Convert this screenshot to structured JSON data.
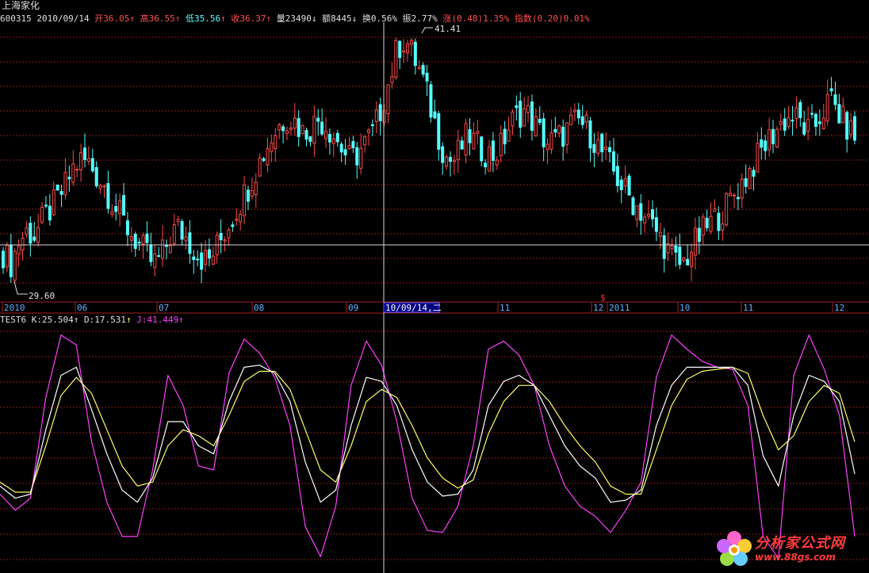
{
  "stock": {
    "name": "上海家化",
    "code": "600315",
    "date": "2010/09/14",
    "open_label": "开",
    "open": "36.05",
    "high_label": "高",
    "high": "36.55",
    "low_label": "低",
    "low": "35.56",
    "close_label": "收",
    "close": "36.37",
    "vol_label": "量",
    "vol": "23490",
    "amt_label": "额",
    "amt": "8445",
    "turn_label": "换",
    "turn": "0.56%",
    "amp_label": "振",
    "amp": "2.77%",
    "chg_label": "涨",
    "chg": "(0.48)",
    "chg_pct": "1.35%",
    "idx_label": "指数",
    "idx": "(0.20)",
    "idx_pct": "0.01%"
  },
  "price_marks": {
    "high": "41.41",
    "low": "29.60"
  },
  "x_axis": {
    "labels": [
      "2010",
      "06",
      "07",
      "08",
      "09",
      "11",
      "12",
      "2011",
      "10",
      "11",
      "12"
    ],
    "cursor_label": "10/09/14,二",
    "marker": "$"
  },
  "indicator": {
    "name": "TEST6",
    "k_label": "K:",
    "k": "25.504",
    "d_label": "D:",
    "d": "17.531",
    "j_label": "J:",
    "j": "41.449"
  },
  "watermark": {
    "title": "分析家公式网",
    "url": "www.88gs.com"
  },
  "colors": {
    "up": "#ff4a4a",
    "down": "#54ffff",
    "k": "#ffffff",
    "d": "#ffff66",
    "j": "#ff40ff",
    "grid": "#8a1a1a"
  },
  "chart_data": [
    {
      "type": "candlestick",
      "title": "上海家化",
      "x": "trading days (approx. 2010-05 to 2011-12)",
      "ylim": [
        29.6,
        41.41
      ],
      "close_path": [
        31,
        30.5,
        31.5,
        32,
        31.8,
        32.5,
        33,
        33.5,
        34.2,
        35,
        35.3,
        35.1,
        34.5,
        34,
        33.2,
        32.6,
        32,
        31.5,
        31,
        30.5,
        30.8,
        31.6,
        32.2,
        31.8,
        31.3,
        30.8,
        30.6,
        31.2,
        31.9,
        32.6,
        33.3,
        34,
        34.8,
        35.6,
        36.3,
        36.9,
        37.3,
        37.1,
        36.6,
        36.8,
        37.2,
        36.9,
        36.4,
        35.8,
        35.3,
        35.6,
        36.1,
        36.6,
        37.8,
        39,
        40.5,
        40.9,
        40.1,
        39.3,
        38,
        36.7,
        35.5,
        35.2,
        35.8,
        36.5,
        36,
        35.7,
        35.5,
        35.8,
        36.7,
        37.3,
        37.6,
        37.2,
        36.6,
        36.1,
        36.2,
        36.5,
        36.9,
        37.1,
        36.8,
        36.2,
        35.6,
        35,
        34.4,
        33.8,
        33.3,
        32.9,
        32.4,
        31.9,
        31.3,
        30.7,
        30.4,
        31,
        31.6,
        32.1,
        32.5,
        32.8,
        33.3,
        33.9,
        34.4,
        35,
        35.6,
        36.2,
        36.7,
        37.1,
        37.3,
        37.1,
        36.6,
        36.9,
        37.6,
        38.1,
        37.4,
        36.8,
        36.4
      ]
    },
    {
      "type": "line",
      "title": "TEST6",
      "ylim": [
        0,
        100
      ],
      "series": [
        {
          "name": "K",
          "values": [
            20,
            14,
            16,
            48,
            75,
            79,
            58,
            36,
            18,
            12,
            24,
            52,
            52,
            40,
            36,
            62,
            79,
            80,
            76,
            62,
            32,
            12,
            18,
            50,
            74,
            72,
            60,
            38,
            22,
            15,
            16,
            28,
            60,
            72,
            75,
            70,
            55,
            40,
            30,
            24,
            12,
            13,
            18,
            50,
            70,
            79,
            79,
            79,
            79,
            70,
            35,
            20,
            55,
            75,
            72,
            62,
            26
          ]
        },
        {
          "name": "D",
          "values": [
            22,
            17,
            17,
            40,
            65,
            74,
            66,
            48,
            30,
            20,
            22,
            40,
            48,
            45,
            40,
            55,
            72,
            77,
            77,
            68,
            48,
            28,
            22,
            40,
            62,
            68,
            64,
            50,
            34,
            24,
            19,
            23,
            46,
            62,
            70,
            70,
            62,
            50,
            40,
            32,
            20,
            16,
            16,
            38,
            60,
            73,
            77,
            78,
            79,
            76,
            55,
            38,
            45,
            62,
            70,
            66,
            42
          ]
        },
        {
          "name": "J",
          "values": [
            16,
            8,
            14,
            64,
            95,
            90,
            42,
            12,
            -5,
            -5,
            28,
            75,
            60,
            30,
            28,
            76,
            93,
            86,
            74,
            50,
            0,
            -15,
            10,
            70,
            92,
            80,
            52,
            14,
            -2,
            -3,
            10,
            40,
            88,
            92,
            85,
            70,
            40,
            20,
            10,
            5,
            -3,
            8,
            22,
            74,
            95,
            88,
            82,
            79,
            78,
            60,
            -5,
            -16,
            75,
            95,
            78,
            55,
            -5
          ]
        }
      ]
    }
  ]
}
